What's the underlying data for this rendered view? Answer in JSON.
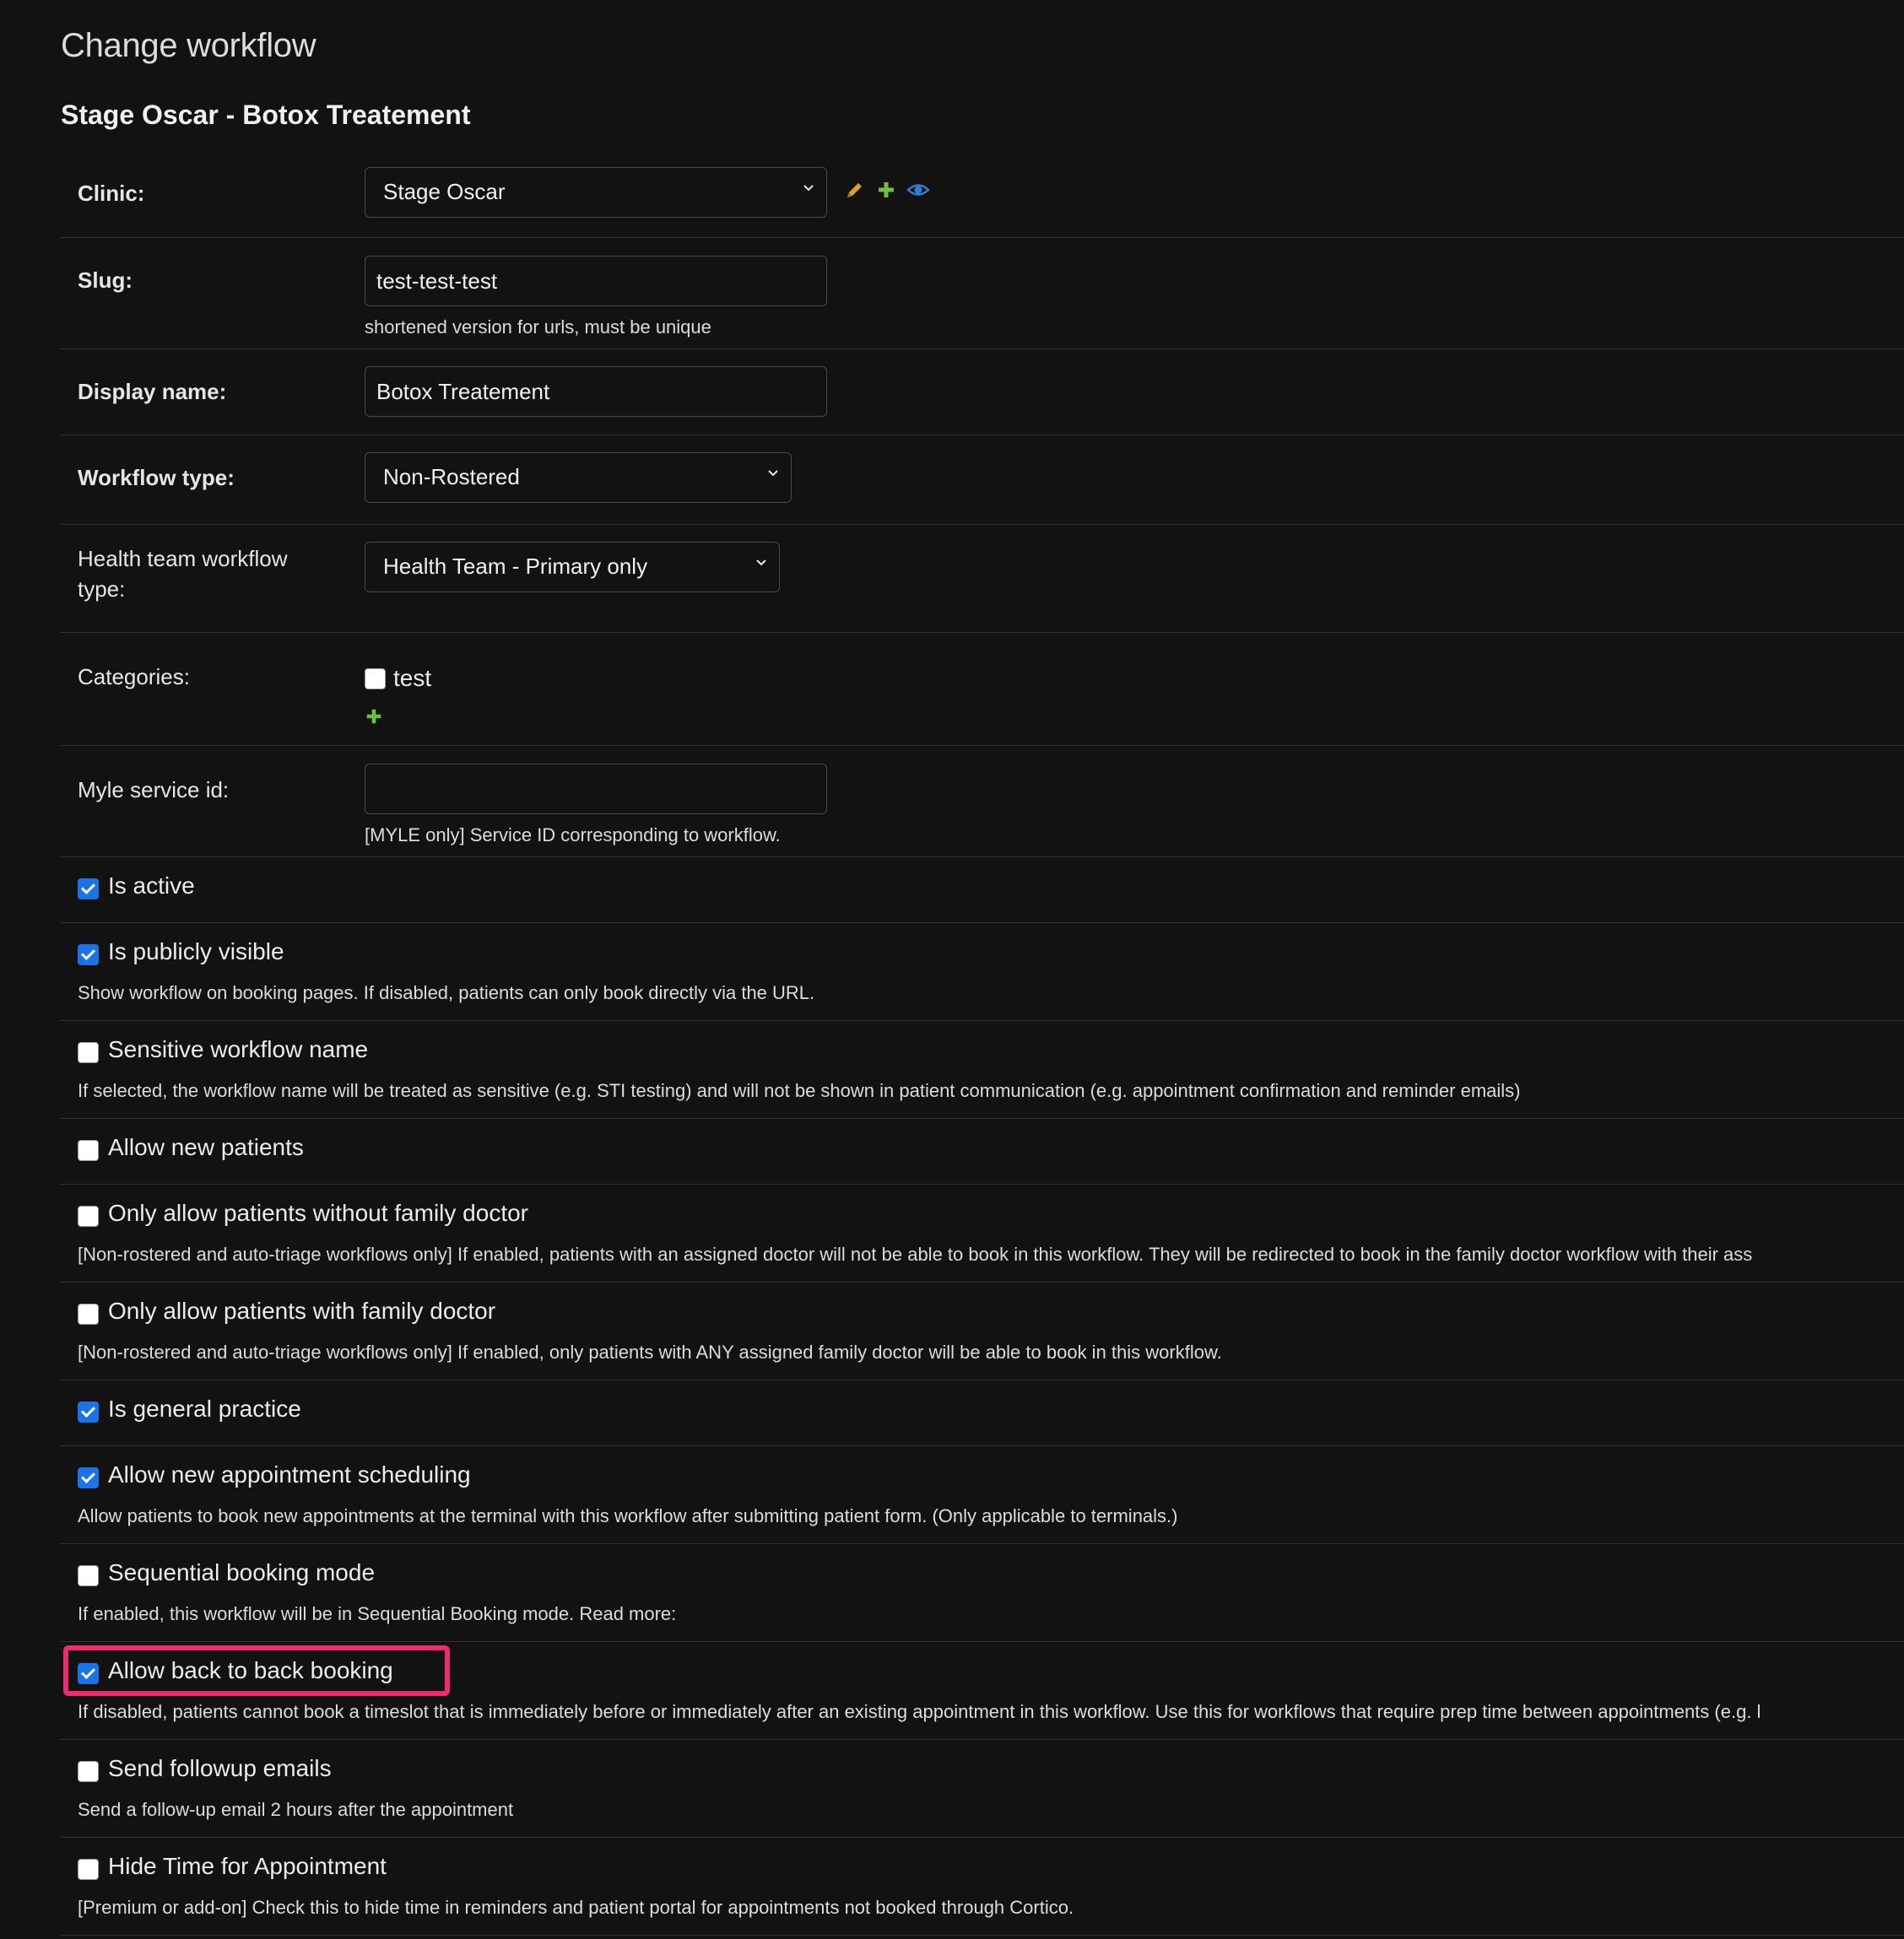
{
  "page_title": "Change workflow",
  "object_title": "Stage Oscar - Botox Treatement",
  "fields": {
    "clinic": {
      "label": "Clinic:",
      "value": "Stage Oscar"
    },
    "slug": {
      "label": "Slug:",
      "value": "test-test-test",
      "help": "shortened version for urls, must be unique"
    },
    "display_name": {
      "label": "Display name:",
      "value": "Botox Treatement"
    },
    "workflow_type": {
      "label": "Workflow type:",
      "value": "Non-Rostered"
    },
    "health_team_type": {
      "label": "Health team workflow type:",
      "value": "Health Team - Primary only"
    },
    "categories": {
      "label": "Categories:",
      "option": "test"
    },
    "myle_service_id": {
      "label": "Myle service id:",
      "value": "",
      "help": "[MYLE only] Service ID corresponding to workflow."
    }
  },
  "checkboxes": [
    {
      "label": "Is active",
      "checked": true,
      "help": ""
    },
    {
      "label": "Is publicly visible",
      "checked": true,
      "help": "Show workflow on booking pages. If disabled, patients can only book directly via the URL."
    },
    {
      "label": "Sensitive workflow name",
      "checked": false,
      "help": "If selected, the workflow name will be treated as sensitive (e.g. STI testing) and will not be shown in patient communication (e.g. appointment confirmation and reminder emails)"
    },
    {
      "label": "Allow new patients",
      "checked": false,
      "help": ""
    },
    {
      "label": "Only allow patients without family doctor",
      "checked": false,
      "help": "[Non-rostered and auto-triage workflows only] If enabled, patients with an assigned doctor will not be able to book in this workflow. They will be redirected to book in the family doctor workflow with their ass"
    },
    {
      "label": "Only allow patients with family doctor",
      "checked": false,
      "help": "[Non-rostered and auto-triage workflows only] If enabled, only patients with ANY assigned family doctor will be able to book in this workflow."
    },
    {
      "label": "Is general practice",
      "checked": true,
      "help": ""
    },
    {
      "label": "Allow new appointment scheduling",
      "checked": true,
      "help": "Allow patients to book new appointments at the terminal with this workflow after submitting patient form. (Only applicable to terminals.)"
    },
    {
      "label": "Sequential booking mode",
      "checked": false,
      "help": "If enabled, this workflow will be in Sequential Booking mode. Read more:"
    },
    {
      "label": "Allow back to back booking",
      "checked": true,
      "help": "If disabled, patients cannot book a timeslot that is immediately before or immediately after an existing appointment in this workflow. Use this for workflows that require prep time between appointments (e.g. l"
    },
    {
      "label": "Send followup emails",
      "checked": false,
      "help": "Send a follow-up email 2 hours after the appointment"
    },
    {
      "label": "Hide Time for Appointment",
      "checked": false,
      "help": "[Premium or add-on] Check this to hide time in reminders and patient portal for appointments not booked through Cortico."
    }
  ],
  "icons": {
    "edit": "pencil-icon",
    "add": "plus-icon",
    "view": "eye-icon"
  },
  "colors": {
    "background": "#121212",
    "checkbox_checked": "#1a73e8",
    "highlight": "#ee2b6e",
    "edit_icon": "#e0a030",
    "add_icon": "#6fbf3a",
    "view_icon": "#2f7fd1"
  }
}
